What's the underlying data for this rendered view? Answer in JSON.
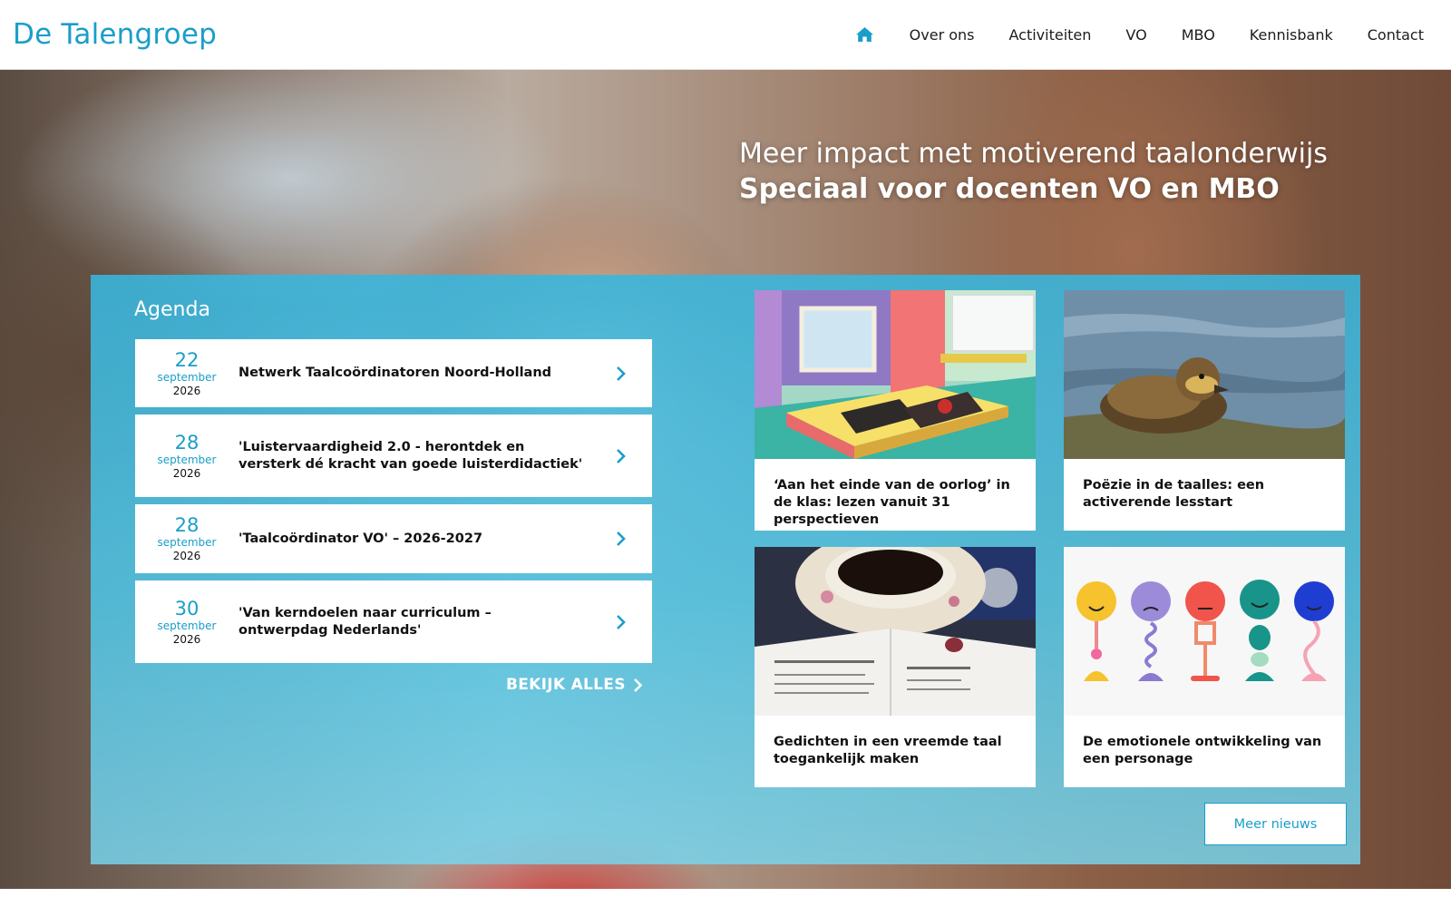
{
  "site": {
    "logo": "De Talengroep"
  },
  "nav": {
    "items": [
      "Over ons",
      "Activiteiten",
      "VO",
      "MBO",
      "Kennisbank",
      "Contact"
    ]
  },
  "hero": {
    "line1": "Meer impact met motiverend taalonderwijs",
    "line2": "Speciaal voor docenten VO en MBO"
  },
  "agenda": {
    "title": "Agenda",
    "items": [
      {
        "day": "22",
        "month": "september",
        "year": "2026",
        "title": "Netwerk Taalcoördinatoren Noord-Holland"
      },
      {
        "day": "28",
        "month": "september",
        "year": "2026",
        "title": "'Luistervaardigheid 2.0 - herontdek en versterk dé kracht van goede luisterdidactiek'"
      },
      {
        "day": "28",
        "month": "september",
        "year": "2026",
        "title": "'Taalcoördinator VO' – 2026-2027"
      },
      {
        "day": "30",
        "month": "september",
        "year": "2026",
        "title": "'Van kerndoelen naar curriculum – ontwerpdag Nederlands'"
      }
    ],
    "view_all": "BEKIJK ALLES"
  },
  "news": {
    "cards": [
      {
        "title": "‘Aan het einde van de oorlog’ in de klas: lezen vanuit 31 perspectieven"
      },
      {
        "title": "Poëzie in de taalles: een activerende lesstart"
      },
      {
        "title": "Gedichten in een vreemde taal toegankelijk maken"
      },
      {
        "title": "De emotionele ontwikkeling van een personage"
      }
    ],
    "more_label": "Meer nieuws"
  },
  "colors": {
    "brand_blue": "#1a9ec9",
    "panel_blue": "#38b6de"
  }
}
